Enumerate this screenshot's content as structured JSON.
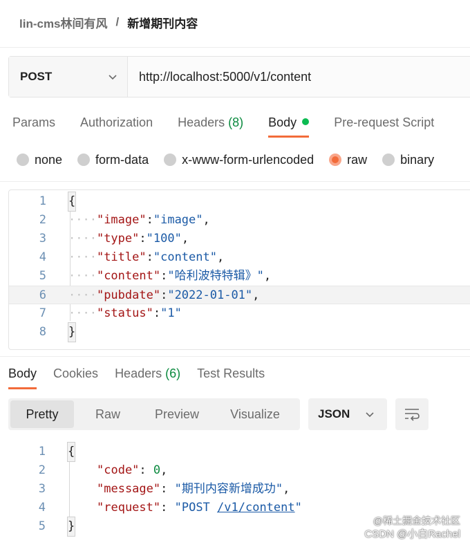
{
  "breadcrumb": {
    "parent": "lin-cms林间有风",
    "separator": "/",
    "current": "新增期刊内容"
  },
  "request": {
    "method": "POST",
    "url": "http://localhost:5000/v1/content"
  },
  "request_tabs": [
    {
      "label": "Params"
    },
    {
      "label": "Authorization"
    },
    {
      "label": "Headers",
      "count": "(8)"
    },
    {
      "label": "Body",
      "active": true
    },
    {
      "label": "Pre-request Script"
    }
  ],
  "body_types": [
    {
      "label": "none"
    },
    {
      "label": "form-data"
    },
    {
      "label": "x-www-form-urlencoded"
    },
    {
      "label": "raw",
      "selected": true
    },
    {
      "label": "binary"
    }
  ],
  "request_body": {
    "line_numbers": [
      "1",
      "2",
      "3",
      "4",
      "5",
      "6",
      "7",
      "8"
    ],
    "open": "{",
    "close": "}",
    "fields": [
      {
        "key": "\"image\"",
        "value": "\"image\"",
        "sep": ","
      },
      {
        "key": "\"type\"",
        "value": "\"100\"",
        "sep": ","
      },
      {
        "key": "\"title\"",
        "value": "\"content\"",
        "sep": ","
      },
      {
        "key": "\"content\"",
        "value": "\"哈利波特特辑》\"",
        "sep": ","
      },
      {
        "key": "\"pubdate\"",
        "value": "\"2022-01-01\"",
        "sep": ","
      },
      {
        "key": "\"status\"",
        "value": "\"1\"",
        "sep": ""
      }
    ],
    "indent": "····",
    "colon": ":"
  },
  "response_tabs": [
    {
      "label": "Body",
      "active": true
    },
    {
      "label": "Cookies"
    },
    {
      "label": "Headers",
      "count": "(6)"
    },
    {
      "label": "Test Results"
    }
  ],
  "view_modes": [
    {
      "label": "Pretty",
      "active": true
    },
    {
      "label": "Raw"
    },
    {
      "label": "Preview"
    },
    {
      "label": "Visualize"
    }
  ],
  "format": {
    "selected": "JSON"
  },
  "response_body": {
    "line_numbers": [
      "1",
      "2",
      "3",
      "4",
      "5"
    ],
    "open": "{",
    "close": "}",
    "code_key": "\"code\"",
    "code_value": "0",
    "message_key": "\"message\"",
    "message_value": "\"期刊内容新增成功\"",
    "request_key": "\"request\"",
    "request_prefix": "\"POST ",
    "request_link": "/v1/content",
    "request_suffix": "\"",
    "colon": ": ",
    "comma": ","
  },
  "watermark": {
    "line1": "@稀土掘金技术社区",
    "line2": "CSDN @小白Rachel"
  },
  "colors": {
    "accent": "#f26b3a",
    "green": "#0cbb52",
    "key": "#a31515",
    "string": "#1b5aa6"
  }
}
